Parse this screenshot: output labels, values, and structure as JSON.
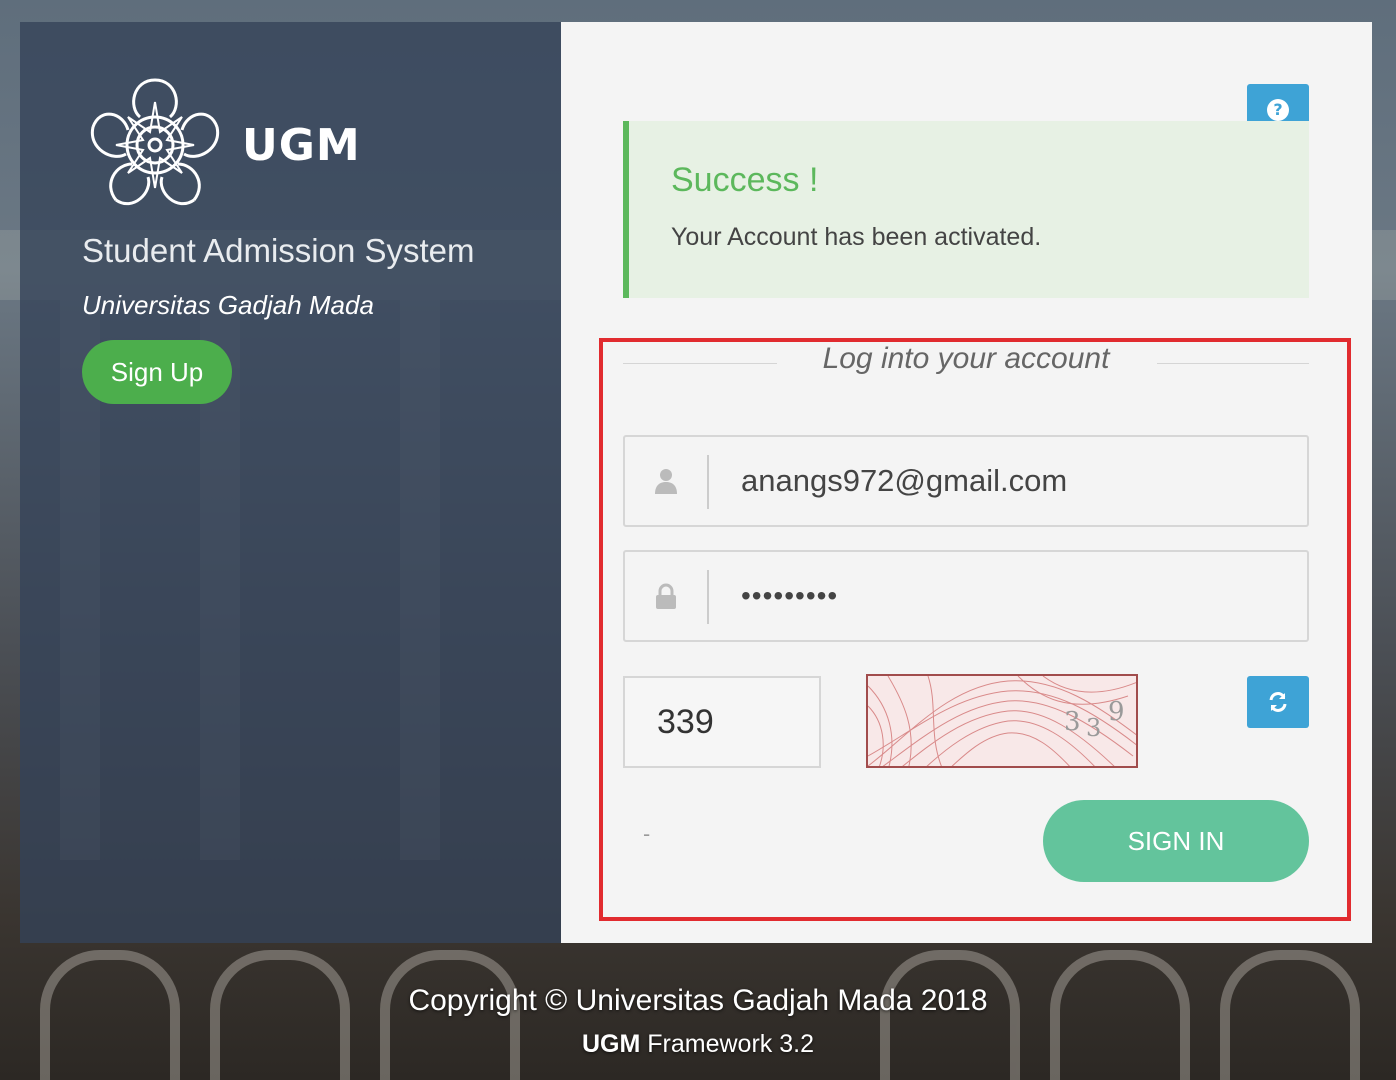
{
  "branding": {
    "logo_text": "UGM",
    "app_title": "Student Admission System",
    "university": "Universitas Gadjah Mada",
    "signup_label": "Sign Up"
  },
  "alert": {
    "title": "Success !",
    "message": "Your Account has been activated."
  },
  "login": {
    "legend": "Log into your account",
    "username_value": "anangs972@gmail.com",
    "password_value": "•••••••••",
    "captcha_value": "339",
    "captcha_image_text": "339",
    "link_text": "-",
    "signin_label": "SIGN IN",
    "user_icon": "user-icon",
    "lock_icon": "lock-icon",
    "refresh_icon": "refresh-icon",
    "help_icon": "question-icon"
  },
  "footer": {
    "copyright": "Copyright © Universitas Gadjah Mada 2018",
    "framework_bold": "UGM",
    "framework_rest": " Framework 3.2"
  },
  "colors": {
    "accent_blue": "#3ea3d6",
    "success_green": "#5cb85c",
    "signin_green": "#63c49c",
    "highlight_red": "#e12b2f"
  }
}
